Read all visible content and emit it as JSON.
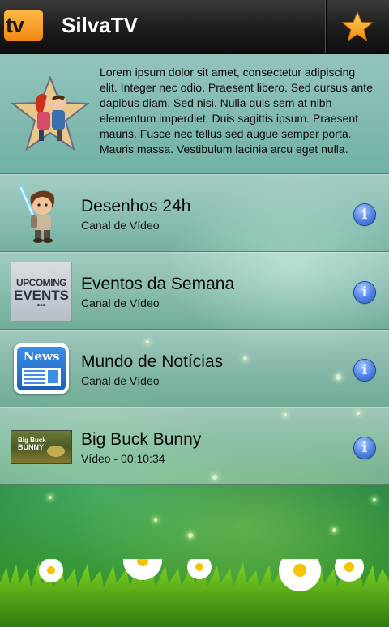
{
  "header": {
    "logo_text": "tv",
    "title": "SilvaTV",
    "favorite_icon": "star-icon",
    "accent": "#f5a623"
  },
  "intro": {
    "text": "Lorem ipsum dolor sit amet, consectetur adipiscing elit. Integer nec odio. Praesent libero. Sed cursus ante dapibus diam. Sed nisi. Nulla quis sem at nibh elementum imperdiet. Duis sagittis ipsum. Praesent mauris. Fusce nec tellus sed augue semper porta. Mauris massa. Vestibulum lacinia arcu eget nulla."
  },
  "channels": [
    {
      "title": "Desenhos 24h",
      "subtitle": "Canal de Vídeo",
      "thumb": "cartoon-character"
    },
    {
      "title": "Eventos da Semana",
      "subtitle": "Canal de Vídeo",
      "thumb": "upcoming-events",
      "thumb_text": [
        "UPCOMING",
        "EVENTS",
        "•••"
      ]
    },
    {
      "title": "Mundo de Notícias",
      "subtitle": "Canal de Vídeo",
      "thumb": "news-icon",
      "thumb_text": [
        "News"
      ]
    },
    {
      "title": "Big Buck Bunny",
      "subtitle": "Vídeo - 00:10:34",
      "thumb": "big-buck-bunny",
      "thumb_text": [
        "Big Buck",
        "BUNNY"
      ]
    }
  ],
  "info_icon": "info-icon"
}
